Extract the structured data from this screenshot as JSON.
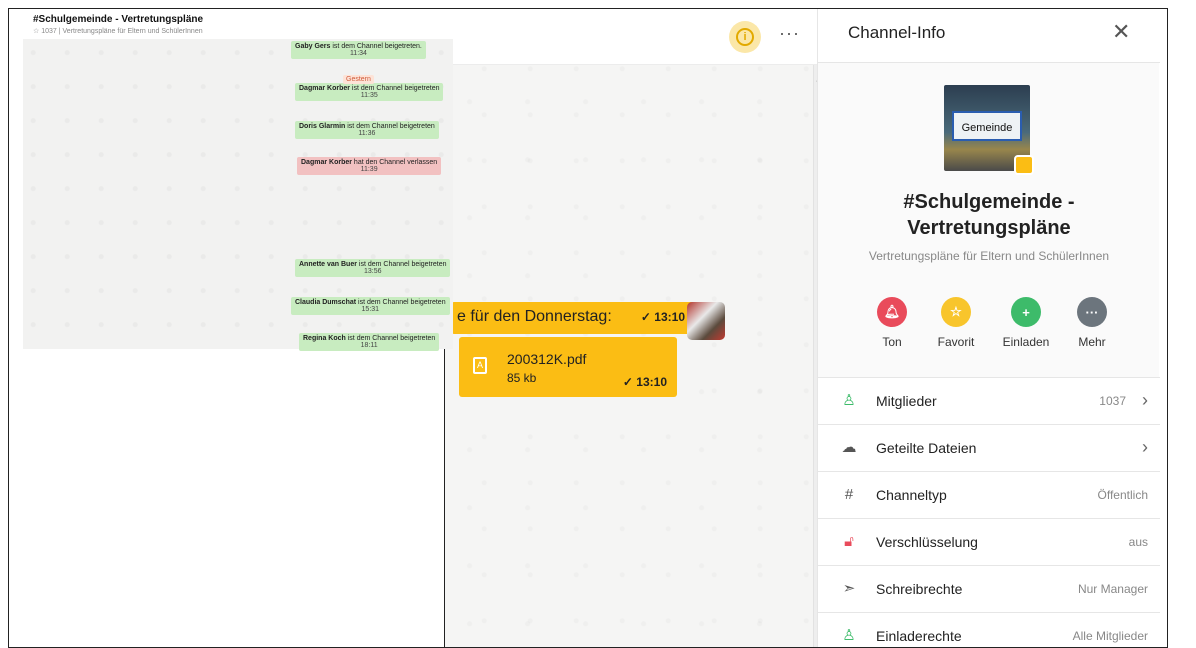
{
  "left": {
    "title": "#Schulgemeinde - Vertretungspläne",
    "subtitle": "1037 | Vertretungspläne für Eltern und SchülerInnen",
    "date_chip": "Gestern",
    "messages": [
      {
        "who": "Gaby Gers",
        "text": "ist dem Channel beigetreten.",
        "time": "11:34",
        "kind": "green"
      },
      {
        "who": "Dagmar Korber",
        "text": "ist dem Channel beigetreten",
        "time": "11:35",
        "kind": "green"
      },
      {
        "who": "Doris Glarmin",
        "text": "ist dem Channel beigetreten",
        "time": "11:36",
        "kind": "green"
      },
      {
        "who": "Dagmar Korber",
        "text": "hat den Channel verlassen",
        "time": "11:39",
        "kind": "red"
      },
      {
        "who": "Annette van Buer",
        "text": "ist dem Channel beigetreten",
        "time": "13:56",
        "kind": "green"
      },
      {
        "who": "Claudia Dumschat",
        "text": "ist dem Channel beigetreten",
        "time": "15:31",
        "kind": "green"
      },
      {
        "who": "Regina Koch",
        "text": "ist dem Channel beigetreten",
        "time": "18:11",
        "kind": "green"
      }
    ]
  },
  "chat": {
    "more_label": "···",
    "text_message": "e für den Donnerstag:",
    "text_time": "✓ 13:10",
    "file": {
      "name": "200312K.pdf",
      "size": "85 kb",
      "time": "✓ 13:10"
    }
  },
  "panel": {
    "title": "Channel-Info",
    "image_label": "Gemeinde",
    "channel_name_line1": "#Schulgemeinde -",
    "channel_name_line2": "Vertretungspläne",
    "description": "Vertretungspläne für Eltern und SchülerInnen",
    "actions": [
      {
        "label": "Ton",
        "icon": "bell-icon"
      },
      {
        "label": "Favorit",
        "icon": "star-icon"
      },
      {
        "label": "Einladen",
        "icon": "add-user-icon"
      },
      {
        "label": "Mehr",
        "icon": "more-icon"
      }
    ],
    "rows": [
      {
        "label": "Mitglieder",
        "value": "1037",
        "icon": "user-icon"
      },
      {
        "label": "Geteilte Dateien",
        "value": "",
        "icon": "cloud-icon"
      },
      {
        "label": "Channeltyp",
        "value": "Öffentlich",
        "icon": "hash-icon"
      },
      {
        "label": "Verschlüsselung",
        "value": "aus",
        "icon": "lock-icon"
      },
      {
        "label": "Schreibrechte",
        "value": "Nur Manager",
        "icon": "megaphone-icon"
      },
      {
        "label": "Einladerechte",
        "value": "Alle Mitglieder",
        "icon": "invite-icon"
      }
    ]
  },
  "colors": {
    "accent": "#fbbd14",
    "join": "#c8ecc0",
    "leave": "#f2c1c1"
  }
}
